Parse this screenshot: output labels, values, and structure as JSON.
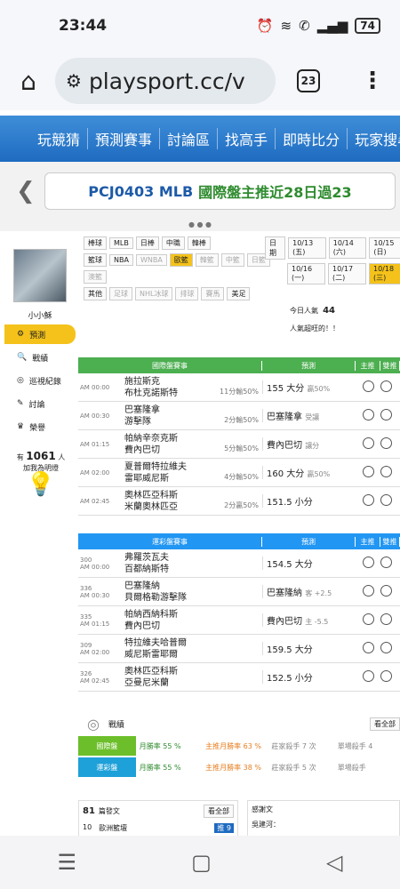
{
  "status": {
    "time": "23:44",
    "battery": "74"
  },
  "browser": {
    "url": "playsport.cc/v",
    "tabs": "23"
  },
  "nav": [
    "玩競猜",
    "預測賽事",
    "討論區",
    "找高手",
    "即時比分",
    "玩家搜尋"
  ],
  "banner": {
    "code": "PCJ0403",
    "league": "MLB",
    "title": "國際盤主推近28日過23"
  },
  "sidebar": {
    "username": "小小穌",
    "menu": [
      "預測",
      "戰績",
      "巡視紀錄",
      "討論",
      "榮譽"
    ],
    "fans_prefix": "有",
    "fans_count": "1061",
    "fans_suffix": "人",
    "fans_line2": "加我為明燈"
  },
  "filters": {
    "row1_label": "棒球",
    "row1": [
      "MLB",
      "日棒",
      "中職",
      "韓棒"
    ],
    "row2_label": "籃球",
    "row2": [
      "NBA",
      "WNBA",
      "歐籃",
      "韓籃",
      "中籃",
      "日籃",
      "澳籃"
    ],
    "row3_label": "其他",
    "row3": [
      "足球",
      "NHL冰球",
      "排球",
      "賽馬",
      "美足"
    ],
    "date_label": "日期",
    "dates": [
      "10/13 (五)",
      "10/14 (六)",
      "10/15 (日)",
      "10/16 (一)",
      "10/17 (二)",
      "10/18 (三)"
    ]
  },
  "popularity": {
    "label": "今日人氣",
    "value": "44",
    "note": "人氣超旺的！！"
  },
  "intl": {
    "header": [
      "國際盤賽事",
      "預測",
      "主推",
      "雙推"
    ],
    "rows": [
      {
        "time": "AM 00:00",
        "t1": "施拉斯克",
        "t2": "布杜克諾斯特",
        "odds": "11分輸50%",
        "pick": "155 大分",
        "sub": "贏50%"
      },
      {
        "time": "AM 00:30",
        "t1": "巴塞隆拿",
        "t2": "游擊隊",
        "odds": "2分輸50%",
        "pick": "巴塞隆拿",
        "sub": "受讓"
      },
      {
        "time": "AM 01:15",
        "t1": "帕納辛奈克斯",
        "t2": "費內巴切",
        "odds": "5分輸50%",
        "pick": "費內巴切",
        "sub": "讓分"
      },
      {
        "time": "AM 02:00",
        "t1": "夏普爾特拉維夫",
        "t2": "雷耶威尼斯",
        "odds": "4分輸50%",
        "pick": "160 大分",
        "sub": "贏50%"
      },
      {
        "time": "AM 02:45",
        "t1": "奧林匹亞科斯",
        "t2": "米蘭奧林匹亞",
        "odds": "2分贏50%",
        "pick": "151.5 小分",
        "sub": ""
      }
    ]
  },
  "lottery": {
    "header": [
      "運彩盤賽事",
      "預測",
      "主推",
      "雙推"
    ],
    "rows": [
      {
        "num": "300",
        "time": "AM 00:00",
        "t1": "弗羅茨瓦夫",
        "t2": "百都納斯特",
        "pick": "154.5 大分",
        "sub": ""
      },
      {
        "num": "336",
        "time": "AM 00:30",
        "t1": "巴塞隆納",
        "t2": "貝爾格勒游擊隊",
        "pick": "巴塞隆納",
        "sub": "客 +2.5"
      },
      {
        "num": "335",
        "time": "AM 01:15",
        "t1": "帕納西納科斯",
        "t2": "費內巴切",
        "pick": "費內巴切",
        "sub": "主 -5.5"
      },
      {
        "num": "309",
        "time": "AM 02:00",
        "t1": "特拉維夫哈普爾",
        "t2": "威尼斯雷耶爾",
        "pick": "159.5 大分",
        "sub": ""
      },
      {
        "num": "326",
        "time": "AM 02:45",
        "t1": "奧林匹亞科斯",
        "t2": "亞曼尼米蘭",
        "pick": "152.5 小分",
        "sub": ""
      }
    ]
  },
  "stats": {
    "title": "戰績",
    "view_all": "看全部",
    "rows": [
      {
        "label": "國際盤",
        "a": "月勝率 55 %",
        "b": "主推月勝率 63 %",
        "c": "莊家殺手 7 次",
        "d": "單場殺手 4"
      },
      {
        "label": "運彩盤",
        "a": "月勝率 55 %",
        "b": "主推月勝率 38 %",
        "c": "莊家殺手 5 次",
        "d": "單場殺手"
      }
    ]
  },
  "bottom": {
    "count": "81",
    "count_label": "篇發文",
    "view_all": "看全部",
    "item_num": "10",
    "item_text": "歐洲籃壇",
    "badge": "推 9",
    "right_title": "感謝文",
    "right_user": "吳建河："
  }
}
